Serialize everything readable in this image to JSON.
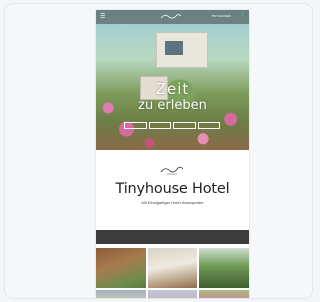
{
  "page": {
    "topbar": {
      "menu_icon": "hamburger-icon",
      "nav_link": "TINYHOUSES",
      "lang_icon": "dots-icon"
    },
    "hero": {
      "title_line1": "Zeit",
      "title_line2": "zu erleben",
      "buttons": [
        "",
        "",
        "",
        ""
      ]
    },
    "brand": {
      "title": "Tinyhouse Hotel",
      "subtitle": "Mit Einzigartiger Hotel-Atmosphäre",
      "meta": ""
    },
    "infobar": {
      "items": [
        "",
        "",
        ""
      ]
    },
    "colors": {
      "dark_bar": "#3b3b3b",
      "flower_accent": "#d66a9e"
    }
  }
}
